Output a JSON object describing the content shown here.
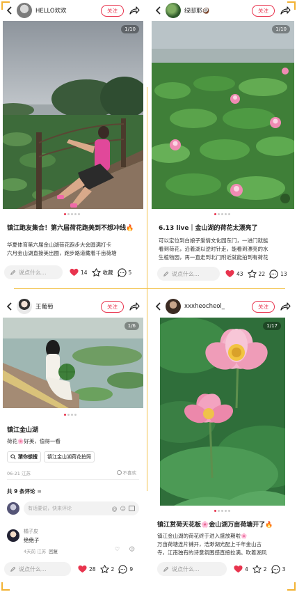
{
  "comment_placeholder": "说点什么...",
  "follow_label": "关注",
  "colors": {
    "accent": "#e8344e",
    "frame_line": "#f2c24a"
  },
  "posts": [
    {
      "username": "HELLO欢欢",
      "image_counter": "1/10",
      "title": "镇江跑友集合！第六届荷花跑美到不想冲线🔥",
      "body_lines": [
        "华夏体育第六届金山湖荷花跑步大会圆满打卡",
        "六月金山湖直接美出圈，跑步路道藏着千亩荷塘"
      ],
      "likes": "14",
      "favorites_label": "收藏",
      "comments": "5"
    },
    {
      "username": "绿邸耶🥥",
      "image_counter": "1/10",
      "title": "6.13 live｜金山湖的荷花太漂亮了",
      "body_lines": [
        "可以定位到白娘子爱情文化园东门，一进门就能",
        "看到荷花，沿着湖以逆时针走，能看到漂亮的水",
        "生植物园，再一直走到北门附近就能拍到有荷花"
      ],
      "likes": "43",
      "favorites": "22",
      "comments": "13"
    },
    {
      "username": "王葡萄",
      "image_counter": "1/6",
      "title": "镇江金山湖",
      "body_line": "荷花🌸好美，值得一看",
      "search_tag_label": "猜你想搜",
      "search_tag_value": "镇江金山湖荷花拍照",
      "date_location": "06-21 江苏",
      "not_like_label": "不喜欢",
      "comments_header": "共 9 条评论",
      "comment_input_placeholder": "有话要说，快来评论",
      "commenter_name": "橘子皮",
      "comment_text": "绝绝子",
      "comment_meta": "4天前 江苏",
      "reply_label": "回复",
      "likes": "28",
      "favorites": "2",
      "comments": "9"
    },
    {
      "username": "xxxheocheol_",
      "image_counter": "1/17",
      "title": "镇江赏荷天花板🌸金山湖万亩荷塘开了🔥",
      "body_lines": [
        "镇江金山湖的荷花终于进入盛放期啦🌸",
        "万亩荷塘连片铺开，浩渺湖光配上千年金山古",
        "寺，江南独有的诗意氛围感直接拉满。吹着湖风"
      ],
      "likes": "4",
      "favorites": "2",
      "comments": "3"
    }
  ]
}
